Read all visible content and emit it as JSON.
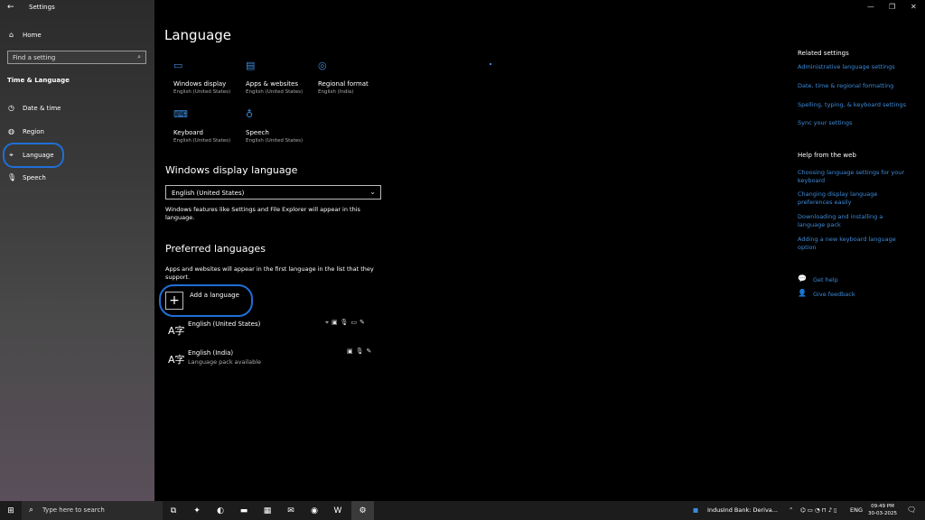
{
  "window": {
    "app_title": "Settings",
    "back_icon": "←",
    "controls": [
      "—",
      "❐",
      "✕"
    ]
  },
  "sidebar": {
    "home": "Home",
    "search_placeholder": "Find a setting",
    "section_title": "Time & Language",
    "items": [
      {
        "label": "Date & time",
        "icon": "calendar-icon"
      },
      {
        "label": "Region",
        "icon": "region-icon"
      },
      {
        "label": "Language",
        "icon": "language-icon"
      },
      {
        "label": "Speech",
        "icon": "microphone-icon"
      }
    ]
  },
  "main": {
    "title": "Language",
    "tiles": [
      {
        "name": "Windows display",
        "sub": "English (United States)",
        "icon": "monitor-icon"
      },
      {
        "name": "Apps & websites",
        "sub": "English (United States)",
        "icon": "window-icon"
      },
      {
        "name": "Regional format",
        "sub": "English (India)",
        "icon": "globe-icon"
      },
      {
        "name": "Keyboard",
        "sub": "English (United States)",
        "icon": "keyboard-icon"
      },
      {
        "name": "Speech",
        "sub": "English (United States)",
        "icon": "microphone-icon"
      }
    ],
    "display_language_heading": "Windows display language",
    "display_language_value": "English (United States)",
    "display_language_note": "Windows features like Settings and File Explorer will appear in this language.",
    "preferred_heading": "Preferred languages",
    "preferred_note": "Apps and websites will appear in the first language in the list that they support.",
    "add_language": "Add a language",
    "languages": [
      {
        "name": "English (United States)",
        "status": ""
      },
      {
        "name": "English (India)",
        "status": "Language pack available"
      }
    ]
  },
  "right": {
    "related_heading": "Related settings",
    "related_links": [
      "Administrative language settings",
      "Date, time & regional formatting",
      "Spelling, typing, & keyboard settings",
      "Sync your settings"
    ],
    "help_heading": "Help from the web",
    "help_links": [
      "Choosing language settings for your keyboard",
      "Changing display language preferences easily",
      "Downloading and installing a language pack",
      "Adding a new keyboard language option"
    ],
    "get_help": "Get help",
    "give_feedback": "Give feedback"
  },
  "taskbar": {
    "search_placeholder": "Type here to search",
    "news_text": "IndusInd Bank: Deriva...",
    "lang": "ENG",
    "time": "09:49 PM",
    "date": "30-03-2025"
  }
}
